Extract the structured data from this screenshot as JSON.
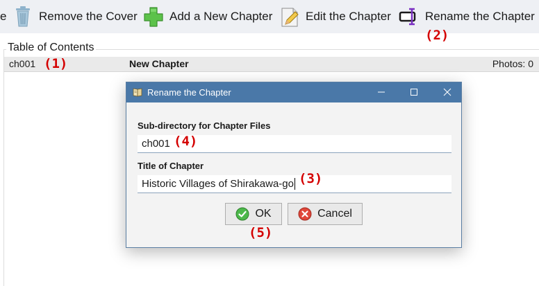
{
  "toolbar": {
    "cut_label": "e",
    "items": [
      {
        "label": "Remove the Cover",
        "icon": "trash-icon"
      },
      {
        "label": "Add a New Chapter",
        "icon": "green-plus-icon"
      },
      {
        "label": "Edit the Chapter",
        "icon": "pencil-paper-icon"
      },
      {
        "label": "Rename the Chapter",
        "icon": "rename-cursor-icon"
      }
    ]
  },
  "annotations": {
    "a1": "(1)",
    "a2": "(2)",
    "a3": "(3)",
    "a4": "(4)",
    "a5": "(5)"
  },
  "toc": {
    "title": "Table of Contents",
    "rows": [
      {
        "dir": "ch001",
        "title": "New Chapter",
        "photos": "Photos: 0"
      }
    ]
  },
  "dialog": {
    "title": "Rename the Chapter",
    "subdir_label": "Sub-directory for Chapter Files",
    "subdir_value": "ch001",
    "title_label": "Title of Chapter",
    "title_value": "Historic Villages of Shirakawa-go",
    "ok_label": "OK",
    "cancel_label": "Cancel"
  },
  "colors": {
    "titlebar": "#4a78a8",
    "annotation": "#d40000",
    "toolbar_bg": "#eef0f4"
  }
}
